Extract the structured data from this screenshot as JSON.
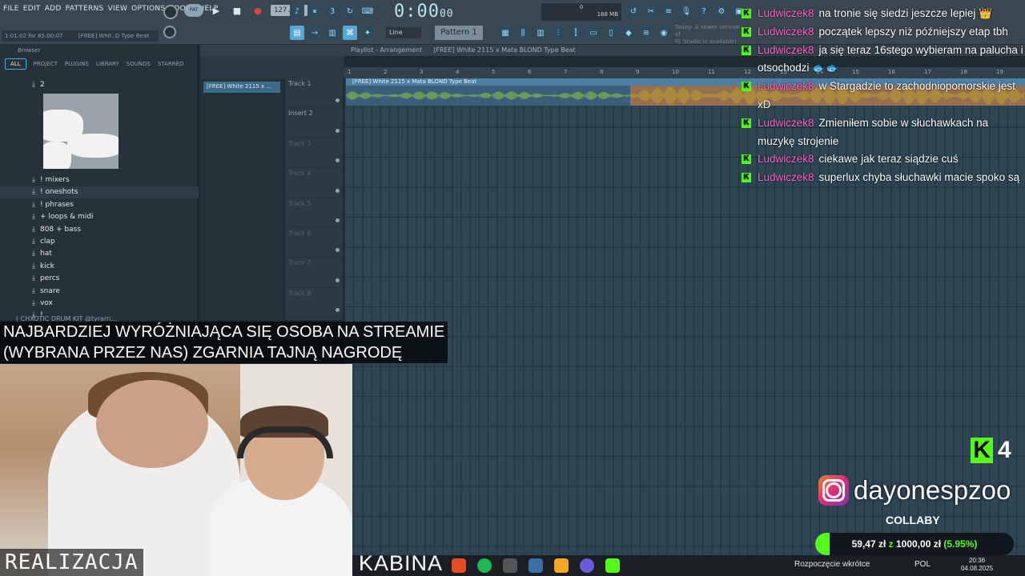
{
  "fl": {
    "menu": [
      "FILE",
      "EDIT",
      "ADD",
      "PATTERNS",
      "VIEW",
      "OPTIONS",
      "TOOLS",
      "HELP"
    ],
    "hint_time": "1:01:02 for 85:00:07",
    "hint_title": "[FREE] Whit..D Type Beat",
    "pat_song_label": "PAT",
    "tempo": "127.000",
    "time_main": "0:00",
    "time_sub": "00",
    "cpu_ram": "168 MB",
    "cpu_val": "0",
    "line_select": "Line",
    "pattern_select": "Pattern 1",
    "news_line1": "Today: A newer version of",
    "news_line2": "FL Studio is available!"
  },
  "browser": {
    "header": "Browser",
    "tabs": [
      "ALL",
      "PROJECT",
      "PLUGINS",
      "LIBRARY",
      "SOUNDS",
      "STARRED"
    ],
    "top_folder": "2",
    "folders": [
      "! mixers",
      "! oneshots",
      "! phrases",
      "+ loops & midi",
      "808 + bass",
      "clap",
      "hat",
      "kick",
      "percs",
      "snare",
      "vox",
      "!"
    ],
    "drumkit": "( CHXOTIC DRUM KIT @tyrarri..."
  },
  "playlist": {
    "breadcrumb_prefix": "Playlist - Arrangement",
    "title": "[FREE] White 2115 x Mata BLOND Type Beat",
    "pattern_chip": "[FREE] White 2115 x ...",
    "clip_label": "[FREE] White 2115 x Mata BLOND Type Beat",
    "tracks": [
      "Track 1",
      "Insert 2",
      "Track 3",
      "Track 4",
      "Track 5",
      "Track 6",
      "Track 7",
      "Track 8"
    ],
    "ruler": [
      "1",
      "2",
      "3",
      "4",
      "5",
      "6",
      "7",
      "8",
      "9",
      "10",
      "11",
      "12",
      "13",
      "14",
      "15",
      "16",
      "17",
      "18",
      "19"
    ]
  },
  "chat": {
    "badge": "K",
    "messages": [
      {
        "user": "Ludwiczek8",
        "text": "na tronie się siedzi jeszcze lepiej",
        "emoji": "👑"
      },
      {
        "user": "Ludwiczek8",
        "text": "początek lepszy niż późniejszy etap tbh",
        "emoji": ""
      },
      {
        "user": "Ludwiczek8",
        "text": "ja się teraz 16stego wybieram na palucha i otsochodzi",
        "emoji": "🐟🐟"
      },
      {
        "user": "Ludwiczek8",
        "text": "w Stargadzie to zachodniopomorskie jest xD",
        "emoji": ""
      },
      {
        "user": "Ludwiczek8",
        "text": "Zmieniłem sobie w słuchawkach na muzykę strojenie",
        "emoji": ""
      },
      {
        "user": "Ludwiczek8",
        "text": "ciekawe jak teraz siądzie cuś",
        "emoji": ""
      },
      {
        "user": "Ludwiczek8",
        "text": "superlux chyba słuchawki macie spoko są",
        "emoji": ""
      }
    ]
  },
  "overlay": {
    "banner_line1": "NAJBARDZIEJ WYRÓŻNIAJĄCA SIĘ OSOBA NA STREAMIE",
    "banner_line2": "(WYBRANA PRZEZ NAS) ZGARNIA TAJNĄ NAGRODĘ",
    "cam_label": "REALIZACJA",
    "kabina": "KABINA",
    "kick_letter": "K",
    "viewers": "4",
    "instagram": "dayonespzoo",
    "collaby": "COLLABY",
    "goal_current": "59,47 zł",
    "goal_sep": "z",
    "goal_target": "1000,00 zł",
    "goal_percent": "(5.95%)",
    "goal_fraction": 0.0595,
    "accent": "#53fc18"
  },
  "taskbar": {
    "news": "Rozpoczęcie wkrótce",
    "lang": "POL",
    "time": "20:36",
    "date": "04.08.2025"
  }
}
